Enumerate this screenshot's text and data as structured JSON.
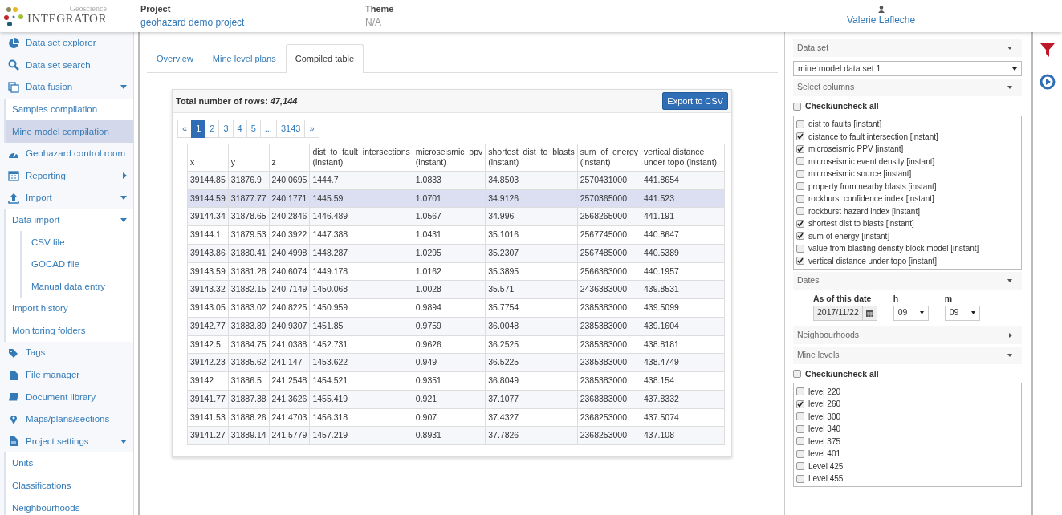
{
  "header": {
    "logo_small": "Geoscience",
    "logo_main": "INTEGRATOR",
    "project_label": "Project",
    "project_name": "geohazard demo project",
    "theme_label": "Theme",
    "theme_value": "N/A",
    "user": "Valerie Lafleche"
  },
  "sidebar": {
    "items": [
      {
        "label": "Data set explorer"
      },
      {
        "label": "Data set search"
      },
      {
        "label": "Data fusion",
        "expanded": true,
        "children": [
          {
            "label": "Samples compilation",
            "selected": false
          },
          {
            "label": "Mine model compilation",
            "selected": true
          }
        ]
      },
      {
        "label": "Geohazard control room"
      },
      {
        "label": "Reporting",
        "expanded": false
      },
      {
        "label": "Import",
        "expanded": true,
        "children": [
          {
            "label": "Data import",
            "expanded": true,
            "selected": false,
            "children": [
              {
                "label": "CSV file"
              },
              {
                "label": "GOCAD file"
              },
              {
                "label": "Manual data entry"
              }
            ]
          },
          {
            "label": "Import history",
            "selected": false
          },
          {
            "label": "Monitoring folders",
            "selected": false
          }
        ]
      },
      {
        "label": "Tags"
      },
      {
        "label": "File manager"
      },
      {
        "label": "Document library"
      },
      {
        "label": "Maps/plans/sections"
      },
      {
        "label": "Project settings",
        "expanded": true,
        "children": [
          {
            "label": "Units",
            "selected": false
          },
          {
            "label": "Classifications",
            "selected": false
          },
          {
            "label": "Neighbourhoods",
            "selected": false
          }
        ]
      }
    ]
  },
  "tabs": [
    {
      "label": "Overview",
      "selected": false
    },
    {
      "label": "Mine level plans",
      "selected": false
    },
    {
      "label": "Compiled table",
      "selected": true
    }
  ],
  "table_card": {
    "total_label": "Total number of rows:",
    "total_value": "47,144",
    "export_button": "Export to CSV",
    "pagination": [
      {
        "label": "«",
        "selected": false
      },
      {
        "label": "1",
        "selected": true
      },
      {
        "label": "2",
        "selected": false
      },
      {
        "label": "3",
        "selected": false
      },
      {
        "label": "4",
        "selected": false
      },
      {
        "label": "5",
        "selected": false
      },
      {
        "label": "...",
        "selected": false
      },
      {
        "label": "3143",
        "selected": false
      },
      {
        "label": "»",
        "selected": false
      }
    ],
    "columns": [
      "x",
      "y",
      "z",
      "dist_to_fault_intersections (instant)",
      "microseismic_ppv (instant)",
      "shortest_dist_to_blasts (instant)",
      "sum_of_energy (instant)",
      "vertical distance under topo (instant)"
    ],
    "rows": [
      {
        "selected": false,
        "cells": [
          "39144.85",
          "31876.9",
          "240.0695",
          "1444.7",
          "1.0833",
          "34.8503",
          "2570431000",
          "441.8654"
        ]
      },
      {
        "selected": true,
        "cells": [
          "39144.59",
          "31877.77",
          "240.1771",
          "1445.59",
          "1.0701",
          "34.9126",
          "2570365000",
          "441.523"
        ]
      },
      {
        "selected": false,
        "cells": [
          "39144.34",
          "31878.65",
          "240.2846",
          "1446.489",
          "1.0567",
          "34.996",
          "2568265000",
          "441.191"
        ]
      },
      {
        "selected": false,
        "cells": [
          "39144.1",
          "31879.53",
          "240.3922",
          "1447.388",
          "1.0431",
          "35.1016",
          "2567745000",
          "440.8647"
        ]
      },
      {
        "selected": false,
        "cells": [
          "39143.86",
          "31880.41",
          "240.4998",
          "1448.287",
          "1.0295",
          "35.2307",
          "2567485000",
          "440.5389"
        ]
      },
      {
        "selected": false,
        "cells": [
          "39143.59",
          "31881.28",
          "240.6074",
          "1449.178",
          "1.0162",
          "35.3895",
          "2566383000",
          "440.1957"
        ]
      },
      {
        "selected": false,
        "cells": [
          "39143.32",
          "31882.15",
          "240.7149",
          "1450.068",
          "1.0028",
          "35.571",
          "2436383000",
          "439.8531"
        ]
      },
      {
        "selected": false,
        "cells": [
          "39143.05",
          "31883.02",
          "240.8225",
          "1450.959",
          "0.9894",
          "35.7754",
          "2385383000",
          "439.5099"
        ]
      },
      {
        "selected": false,
        "cells": [
          "39142.77",
          "31883.89",
          "240.9307",
          "1451.85",
          "0.9759",
          "36.0048",
          "2385383000",
          "439.1604"
        ]
      },
      {
        "selected": false,
        "cells": [
          "39142.5",
          "31884.75",
          "241.0388",
          "1452.731",
          "0.9626",
          "36.2525",
          "2385383000",
          "438.8181"
        ]
      },
      {
        "selected": false,
        "cells": [
          "39142.23",
          "31885.62",
          "241.147",
          "1453.622",
          "0.949",
          "36.5225",
          "2385383000",
          "438.4749"
        ]
      },
      {
        "selected": false,
        "cells": [
          "39142",
          "31886.5",
          "241.2548",
          "1454.521",
          "0.9351",
          "36.8049",
          "2385383000",
          "438.154"
        ]
      },
      {
        "selected": false,
        "cells": [
          "39141.77",
          "31887.38",
          "241.3626",
          "1455.419",
          "0.921",
          "37.1077",
          "2368383000",
          "437.8332"
        ]
      },
      {
        "selected": false,
        "cells": [
          "39141.53",
          "31888.26",
          "241.4703",
          "1456.318",
          "0.907",
          "37.4327",
          "2368253000",
          "437.5074"
        ]
      },
      {
        "selected": false,
        "cells": [
          "39141.27",
          "31889.14",
          "241.5779",
          "1457.219",
          "0.8931",
          "37.7826",
          "2368253000",
          "437.108"
        ]
      }
    ]
  },
  "panel": {
    "sections": [
      {
        "kind": "select",
        "title": "Data set",
        "expanded": true,
        "value": "mine model data set 1"
      },
      {
        "kind": "checklist",
        "title": "Select columns",
        "expanded": true,
        "check_all": {
          "label": "Check/uncheck all",
          "checked": false
        },
        "items": [
          {
            "label": "dist to faults [instant]",
            "checked": false
          },
          {
            "label": "distance to fault intersection [instant]",
            "checked": true
          },
          {
            "label": "microseismic PPV [instant]",
            "checked": true
          },
          {
            "label": "microseismic event density [instant]",
            "checked": false
          },
          {
            "label": "microseismic source [instant]",
            "checked": false
          },
          {
            "label": "property from nearby blasts [instant]",
            "checked": false
          },
          {
            "label": "rockburst confidence index [instant]",
            "checked": false
          },
          {
            "label": "rockburst hazard index [instant]",
            "checked": false
          },
          {
            "label": "shortest dist to blasts [instant]",
            "checked": true
          },
          {
            "label": "sum of energy [instant]",
            "checked": true
          },
          {
            "label": "value from blasting density block model [instant]",
            "checked": false
          },
          {
            "label": "vertical distance under topo [instant]",
            "checked": true
          }
        ]
      },
      {
        "kind": "dates",
        "title": "Dates",
        "expanded": true,
        "date_label": "As of this date",
        "date_value": "2017/11/22",
        "hour_label": "h",
        "hour_value": "09",
        "minute_label": "m",
        "minute_value": "09"
      },
      {
        "kind": "collapsed",
        "title": "Neighbourhoods",
        "expanded": false
      },
      {
        "kind": "checklist",
        "title": "Mine levels",
        "expanded": true,
        "check_all": {
          "label": "Check/uncheck all",
          "checked": false
        },
        "items": [
          {
            "label": "level 220",
            "checked": false
          },
          {
            "label": "level 260",
            "checked": true
          },
          {
            "label": "level 300",
            "checked": false
          },
          {
            "label": "level 340",
            "checked": false
          },
          {
            "label": "level 375",
            "checked": false
          },
          {
            "label": "level 401",
            "checked": false
          },
          {
            "label": "Level 425",
            "checked": false
          },
          {
            "label": "Level 455",
            "checked": false
          }
        ]
      }
    ]
  }
}
